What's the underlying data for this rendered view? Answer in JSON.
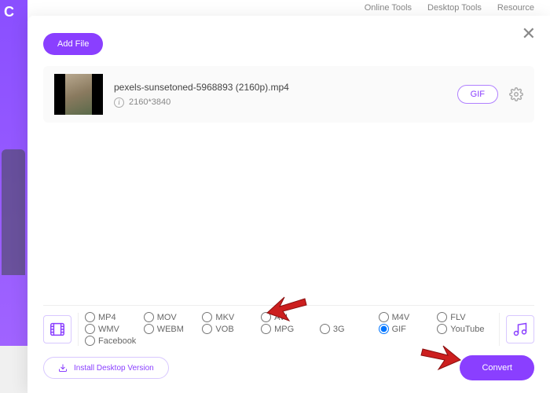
{
  "bgHeader": {
    "onlineTools": "Online Tools",
    "desktopTools": "Desktop Tools",
    "resources": "Resource"
  },
  "bgLogo": "C",
  "addFile": "Add File",
  "file": {
    "name": "pexels-sunsetoned-5968893 (2160p).mp4",
    "resolution": "2160*3840",
    "formatBadge": "GIF"
  },
  "formats": {
    "row1": [
      "MP4",
      "MOV",
      "MKV",
      "AVI",
      "",
      "M4V",
      "FLV",
      "WMV"
    ],
    "row2": [
      "WEBM",
      "VOB",
      "MPG",
      "3G",
      "GIF",
      "YouTube",
      "Facebook"
    ],
    "selected": "GIF"
  },
  "install": "Install Desktop Version",
  "convert": "Convert"
}
